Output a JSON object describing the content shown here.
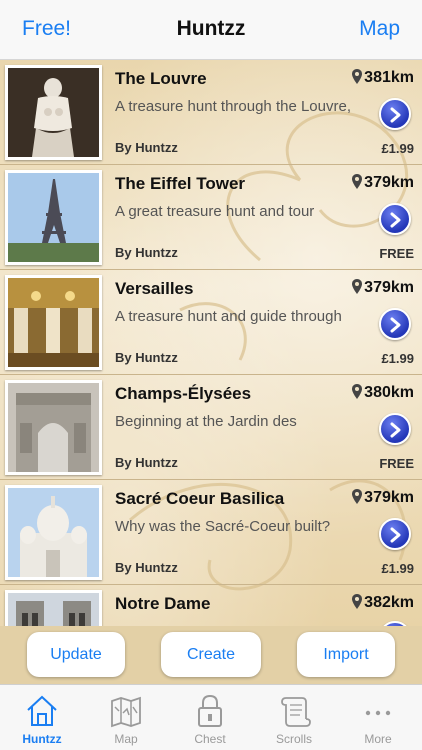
{
  "navbar": {
    "left_label": "Free!",
    "title": "Huntzz",
    "right_label": "Map"
  },
  "hunts": [
    {
      "title": "The Louvre",
      "distance": "381km",
      "description": "A treasure hunt through the Louvre,",
      "author": "By Huntzz",
      "price": "£1.99",
      "thumb": "statue-photo"
    },
    {
      "title": "The Eiffel Tower",
      "distance": "379km",
      "description": "A great treasure hunt and tour",
      "author": "By Huntzz",
      "price": "FREE",
      "thumb": "eiffel-photo"
    },
    {
      "title": "Versailles",
      "distance": "379km",
      "description": "A treasure hunt and guide through",
      "author": "By Huntzz",
      "price": "£1.99",
      "thumb": "hall-photo"
    },
    {
      "title": "Champs-Élysées",
      "distance": "380km",
      "description": "Beginning at the Jardin des",
      "author": "By Huntzz",
      "price": "FREE",
      "thumb": "arch-photo"
    },
    {
      "title": "Sacré Coeur Basilica",
      "distance": "379km",
      "description": "Why was the Sacré-Coeur built?",
      "author": "By Huntzz",
      "price": "£1.99",
      "thumb": "basilica-photo"
    },
    {
      "title": "Notre Dame",
      "distance": "382km",
      "description": "",
      "author": "",
      "price": "",
      "thumb": "cathedral-photo"
    }
  ],
  "buttons": {
    "update": "Update",
    "create": "Create",
    "import": "Import"
  },
  "tabs": [
    {
      "label": "Huntzz",
      "icon": "house-icon",
      "active": true
    },
    {
      "label": "Map",
      "icon": "map-icon",
      "active": false
    },
    {
      "label": "Chest",
      "icon": "lock-icon",
      "active": false
    },
    {
      "label": "Scrolls",
      "icon": "scroll-icon",
      "active": false
    },
    {
      "label": "More",
      "icon": "more-dots-icon",
      "active": false
    }
  ],
  "colors": {
    "accent": "#1a7ef2",
    "chevron": "#2f45c8",
    "parchment": "#efe2c6"
  }
}
